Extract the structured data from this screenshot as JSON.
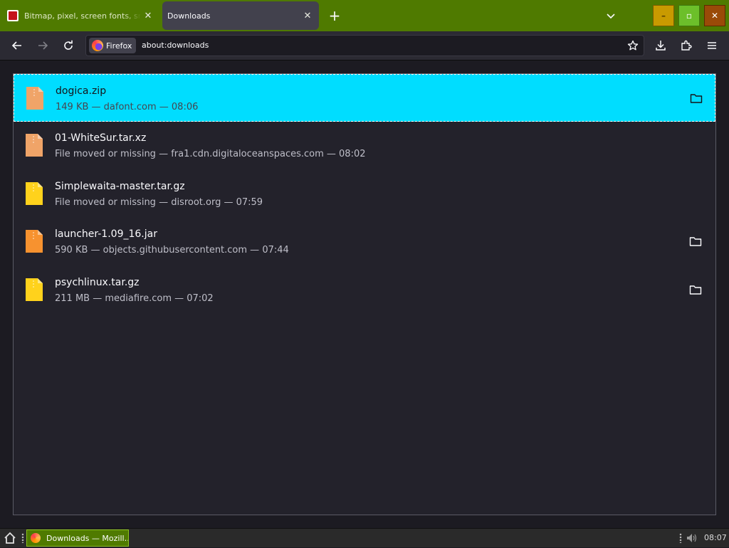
{
  "browser": {
    "tabs": [
      {
        "label": "Bitmap, pixel, screen fonts, small fo",
        "favicon": "dafont-favicon",
        "close": "✕"
      },
      {
        "label": "Downloads",
        "close": "✕"
      }
    ],
    "new_tab": "+",
    "window_controls": {
      "minimize": "–",
      "maximize": "▫",
      "close": "✕"
    },
    "identity_label": "Firefox",
    "url": "about:downloads",
    "colors": {
      "tabstrip": "#4f7a00",
      "selected_row": "#00ddff"
    }
  },
  "downloads": [
    {
      "name": "dogica.zip",
      "meta": "149 KB — dafont.com — 08:06",
      "icon": "zip-file-icon",
      "icon_color": "#f0a468",
      "has_folder": true,
      "selected": true
    },
    {
      "name": "01-WhiteSur.tar.xz",
      "meta": "File moved or missing — fra1.cdn.digitaloceanspaces.com — 08:02",
      "icon": "archive-file-icon",
      "icon_color": "#f0a468",
      "has_folder": false,
      "selected": false
    },
    {
      "name": "Simplewaita-master.tar.gz",
      "meta": "File moved or missing — disroot.org — 07:59",
      "icon": "archive-file-icon",
      "icon_color": "#ffd21c",
      "has_folder": false,
      "selected": false
    },
    {
      "name": "launcher-1.09_16.jar",
      "meta": "590 KB — objects.githubusercontent.com — 07:44",
      "icon": "jar-file-icon",
      "icon_color": "#f7922f",
      "has_folder": true,
      "selected": false
    },
    {
      "name": "psychlinux.tar.gz",
      "meta": "211 MB — mediafire.com — 07:02",
      "icon": "archive-file-icon",
      "icon_color": "#ffd21c",
      "has_folder": true,
      "selected": false
    }
  ],
  "taskbar": {
    "task_label": "Downloads — Mozill…",
    "clock": "08:07"
  }
}
